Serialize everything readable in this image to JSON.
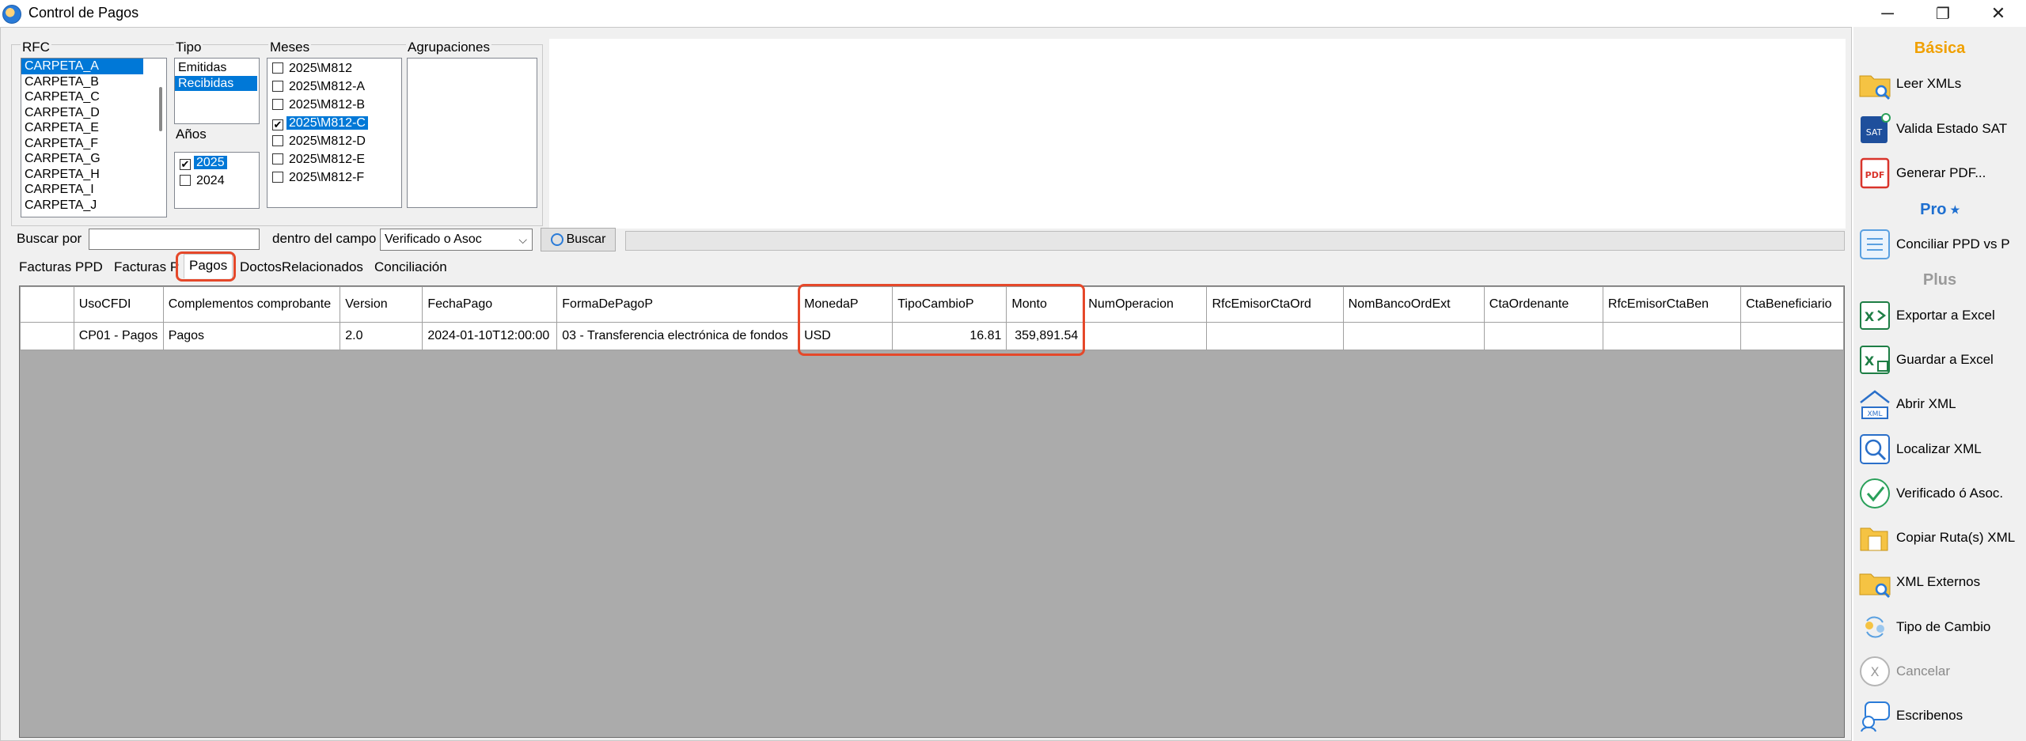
{
  "window": {
    "title": "Control de Pagos",
    "controls": {
      "minimize": "─",
      "restore": "❐",
      "close": "✕"
    }
  },
  "filters": {
    "rfc_label": "RFC",
    "rfc_items": [
      "CARPETA_A",
      "CARPETA_B",
      "CARPETA_C",
      "CARPETA_D",
      "CARPETA_E",
      "CARPETA_F",
      "CARPETA_G",
      "CARPETA_H",
      "CARPETA_I",
      "CARPETA_J"
    ],
    "rfc_selected": "CARPETA_A",
    "tipo_label": "Tipo",
    "tipo_items": [
      "Emitidas",
      "Recibidas"
    ],
    "tipo_selected": "Recibidas",
    "anios_label": "Años",
    "anios_items": [
      {
        "label": "2025",
        "checked": true,
        "selected": true
      },
      {
        "label": "2024",
        "checked": false,
        "selected": false
      }
    ],
    "meses_label": "Meses",
    "meses_items": [
      {
        "label": "2025\\M812",
        "checked": false,
        "selected": false
      },
      {
        "label": "2025\\M812-A",
        "checked": false,
        "selected": false
      },
      {
        "label": "2025\\M812-B",
        "checked": false,
        "selected": false
      },
      {
        "label": "2025\\M812-C",
        "checked": true,
        "selected": true
      },
      {
        "label": "2025\\M812-D",
        "checked": false,
        "selected": false
      },
      {
        "label": "2025\\M812-E",
        "checked": false,
        "selected": false
      },
      {
        "label": "2025\\M812-F",
        "checked": false,
        "selected": false
      }
    ],
    "agrupaciones_label": "Agrupaciones"
  },
  "search": {
    "buscar_por_label": "Buscar por",
    "buscar_value": "",
    "dentro_label": "dentro del campo",
    "campo_value": "Verificado o Asoc",
    "buscar_button": "Buscar"
  },
  "tabs": [
    "Facturas PPD",
    "Facturas P",
    "Pagos",
    "DoctosRelacionados",
    "Conciliación"
  ],
  "active_tab": "Pagos",
  "table": {
    "columns": [
      "",
      "UsoCFDI",
      "Complementos comprobante",
      "Version",
      "FechaPago",
      "FormaDePagoP",
      "MonedaP",
      "TipoCambioP",
      "Monto",
      "NumOperacion",
      "RfcEmisorCtaOrd",
      "NomBancoOrdExt",
      "CtaOrdenante",
      "RfcEmisorCtaBen",
      "CtaBeneficiario"
    ],
    "rows": [
      [
        "",
        "CP01 - Pagos",
        "Pagos",
        "2.0",
        "2024-01-10T12:00:00",
        "03 - Transferencia electrónica de fondos",
        "USD",
        "16.81",
        "359,891.54",
        "",
        "",
        "",
        "",
        "",
        ""
      ]
    ]
  },
  "sidebar": {
    "sections": {
      "basica": "Básica",
      "pro": "Pro ⭑",
      "plus": "Plus"
    },
    "buttons": [
      {
        "label": "Leer XMLs",
        "icon": "folder-search-icon"
      },
      {
        "label": "Valida Estado SAT",
        "icon": "sat-icon"
      },
      {
        "label": "Generar PDF...",
        "icon": "pdf-icon"
      },
      {
        "label": "Conciliar PPD vs P",
        "icon": "reconcile-icon"
      },
      {
        "label": "Exportar a Excel",
        "icon": "excel-export-icon"
      },
      {
        "label": "Guardar a Excel",
        "icon": "excel-save-icon"
      },
      {
        "label": "Abrir XML",
        "icon": "xml-open-icon"
      },
      {
        "label": "Localizar XML",
        "icon": "xml-locate-icon"
      },
      {
        "label": "Verificado ó Asoc.",
        "icon": "check-icon"
      },
      {
        "label": "Copiar Ruta(s) XML",
        "icon": "copy-path-icon"
      },
      {
        "label": "XML Externos",
        "icon": "xml-external-icon"
      },
      {
        "label": "Tipo de Cambio",
        "icon": "exchange-icon"
      },
      {
        "label": "Cancelar",
        "icon": "cancel-icon"
      },
      {
        "label": "Escribenos",
        "icon": "chat-icon"
      }
    ]
  },
  "colors": {
    "accent": "#0078d7",
    "highlight": "#e5482a",
    "section_title": "#f0a000",
    "excel": "#1e7e45",
    "pdf": "#d9342b"
  }
}
